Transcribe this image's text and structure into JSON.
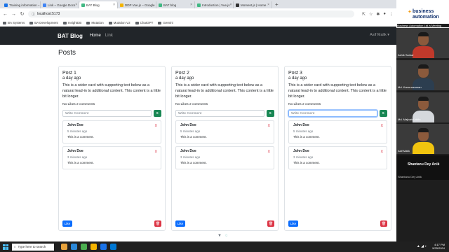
{
  "browser": {
    "tabs": [
      {
        "label": "Training information – Google",
        "color": "#1a73e8",
        "active": false
      },
      {
        "label": "Link – Google Docs",
        "color": "#4285f4",
        "active": false
      },
      {
        "label": "BAT Blog",
        "color": "#41b883",
        "active": true
      },
      {
        "label": "DDP Vue.js – Google Slides",
        "color": "#f4b400",
        "active": false
      },
      {
        "label": "BAT blog",
        "color": "#41b883",
        "active": false
      },
      {
        "label": "Introduction | Vue.js",
        "color": "#41b883",
        "active": false
      },
      {
        "label": "Moment.js | Home",
        "color": "#333333",
        "active": false
      }
    ],
    "address": "localhost:5173",
    "bookmarks": [
      "BA Systems",
      "BA Development",
      "InsightDB",
      "Mutation",
      "Mutation V2",
      "ChatGPT",
      "Gemini"
    ]
  },
  "navbar": {
    "brand": "BAT Blog",
    "links": [
      "Home",
      "Link"
    ],
    "user": "Asif Malik ▾"
  },
  "page": {
    "heading": "Posts",
    "comment_placeholder": "Write Comment",
    "posts": [
      {
        "title": "Post 1",
        "subtitle": "a day ago",
        "text": "This is a wider card with supporting text below as a natural lead-in to additional content. This content is a little bit longer.",
        "stats": "No Likes 2 comments",
        "comments": [
          {
            "author": "John Doe",
            "time": "5 minutes ago",
            "body": "This is a comment."
          },
          {
            "author": "John Doe",
            "time": "3 minutes ago",
            "body": "This is a comment."
          }
        ]
      },
      {
        "title": "Post 2",
        "subtitle": "a day ago",
        "text": "This is a wider card with supporting text below as a natural lead-in to additional content. This content is a little bit longer.",
        "stats": "No Likes 2 comments",
        "comments": [
          {
            "author": "John Doe",
            "time": "5 minutes ago",
            "body": "This is a comment."
          },
          {
            "author": "John Doe",
            "time": "3 minutes ago",
            "body": "This is a comment."
          }
        ]
      },
      {
        "title": "Post 3",
        "subtitle": "a day ago",
        "text": "This is a wider card with supporting text below as a natural lead-in to additional content. This content is a little bit longer.",
        "stats": "No Likes 2 comments",
        "comments": [
          {
            "author": "John Doe",
            "time": "5 minutes ago",
            "body": "This is a comment."
          },
          {
            "author": "John Doe",
            "time": "3 minutes ago",
            "body": "This is a comment."
          }
        ]
      }
    ],
    "like_label": "Like",
    "delete_comment": "X"
  },
  "meeting": {
    "logo_line1": "business",
    "logo_line2": "automation",
    "title": "Business Automation Ltd.'s Meeting",
    "participants": [
      {
        "name": "Ashik Sarkar",
        "shirt": "#c0392b"
      },
      {
        "name": "Md. Kamruzzaman",
        "shirt": "#2c3e50"
      },
      {
        "name": "Md. Majbah Uddin",
        "shirt": "#d5d8dc"
      },
      {
        "name": "Asif Malik",
        "shirt": "#f1c40f"
      }
    ],
    "presenter": "Shantanu Dey Anik",
    "presenter_small": "Shantanu Dey Anik"
  },
  "taskbar": {
    "search": "Type here to search",
    "apps": [
      "#e8a33d",
      "#2b88d8",
      "#4caf50",
      "#f4b400",
      "#1a73e8",
      "#0078d4"
    ],
    "time": "4:17 PM",
    "date": "5/25/2024"
  }
}
